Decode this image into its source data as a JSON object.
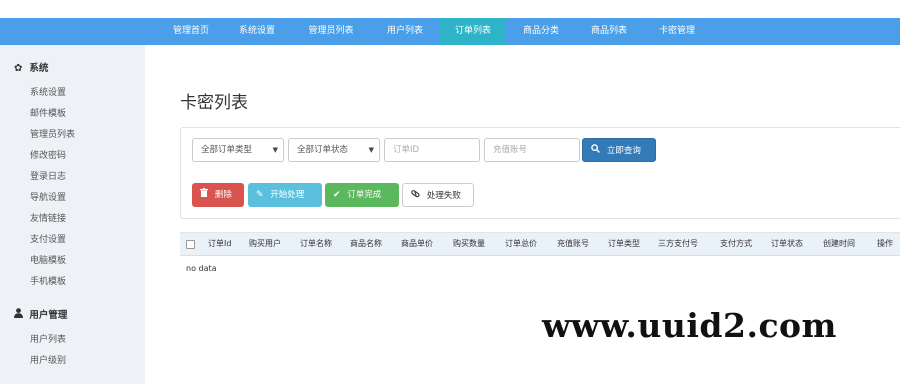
{
  "nav": {
    "items": [
      {
        "label": "管理首页",
        "active": false
      },
      {
        "label": "系统设置",
        "active": false
      },
      {
        "label": "管理员列表",
        "active": false
      },
      {
        "label": "用户列表",
        "active": false
      },
      {
        "label": "订单列表",
        "active": true
      },
      {
        "label": "商品分类",
        "active": false
      },
      {
        "label": "商品列表",
        "active": false
      },
      {
        "label": "卡密管理",
        "active": false
      }
    ],
    "bg_color": "#4a9fe8",
    "active_color": "#2fb3c8"
  },
  "sidebar": {
    "system_header": "系统",
    "system_icon": "gear-icon",
    "system_items": [
      "系统设置",
      "邮件模板",
      "管理员列表",
      "修改密码",
      "登录日志",
      "导航设置",
      "友情链接",
      "支付设置",
      "电脑模板",
      "手机模板"
    ],
    "user_header": "用户管理",
    "user_icon": "user-icon",
    "user_items": [
      "用户列表",
      "用户级别"
    ]
  },
  "main": {
    "title": "卡密列表",
    "filters": {
      "order_type": "全部订单类型",
      "order_status": "全部订单状态",
      "order_no_placeholder": "订单ID",
      "recharge_placeholder": "充值账号",
      "query_button": "立即查询"
    },
    "actions": {
      "delete": "删除",
      "start": "开始处理",
      "complete": "订单完成",
      "fail": "处理失败"
    },
    "table": {
      "columns": [
        "订单Id",
        "购买用户",
        "订单名称",
        "商品名称",
        "商品单价",
        "购买数量",
        "订单总价",
        "充值账号",
        "订单类型",
        "三方支付号",
        "支付方式",
        "订单状态",
        "创建时间",
        "操作"
      ],
      "empty_text": "no data"
    }
  },
  "watermark": "www.uuid2.com"
}
